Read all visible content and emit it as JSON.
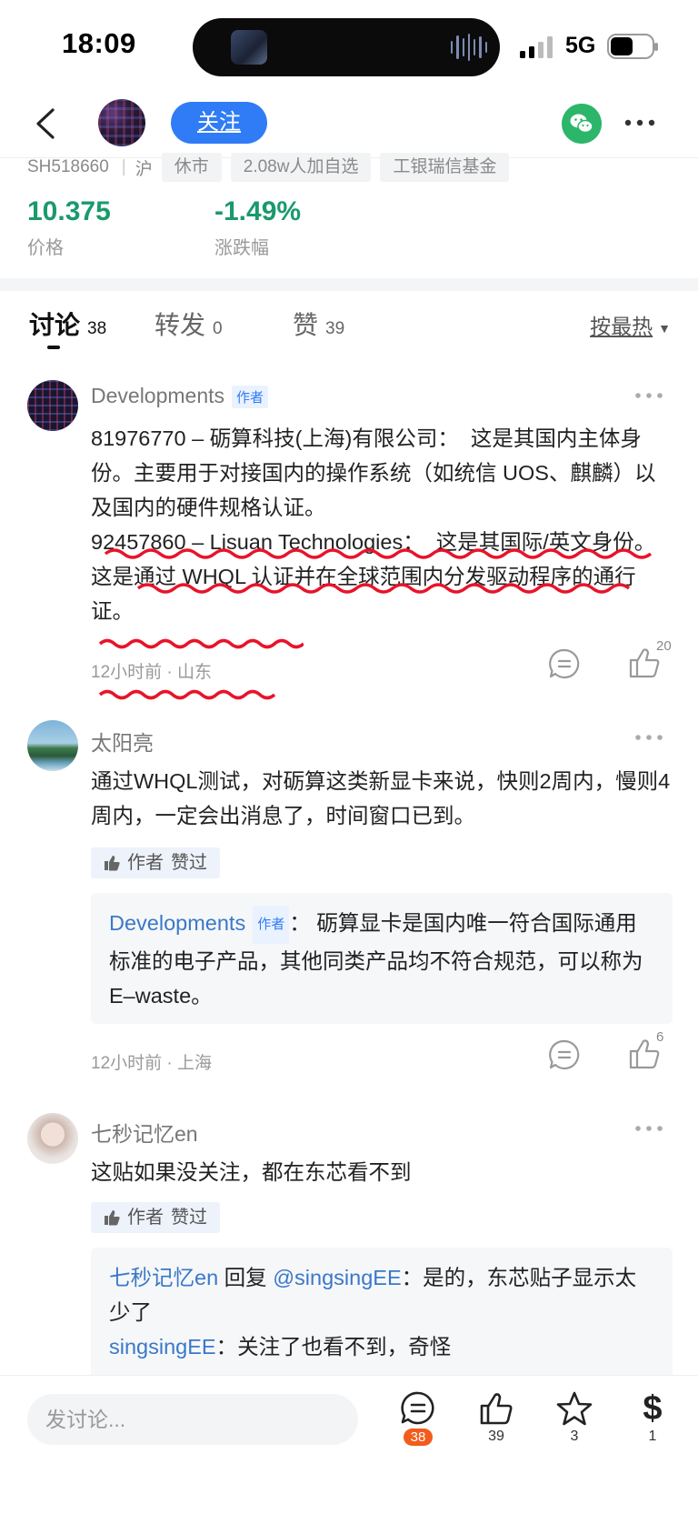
{
  "status_bar": {
    "time": "18:09",
    "network": "5G"
  },
  "nav": {
    "follow_label": "关注"
  },
  "stock": {
    "code": "SH518660",
    "market": "沪",
    "status": "休市",
    "watchers": "2.08w人加自选",
    "company": "工银瑞信基金",
    "price": "10.375",
    "price_label": "价格",
    "change": "-1.49%",
    "change_label": "涨跌幅"
  },
  "tabs": [
    {
      "label": "讨论",
      "count": "38"
    },
    {
      "label": "转发",
      "count": "0"
    },
    {
      "label": "赞",
      "count": "39"
    }
  ],
  "sort_label": "按最热",
  "posts": [
    {
      "author": "Developments",
      "author_badge": "作者",
      "text": "81976770 – 砺算科技(上海)有限公司：  这是其国内主体身份。主要用于对接国内的操作系统（如统信 UOS、麒麟）以及国内的硬件规格认证。\n92457860 – Lisuan Technologies：  这是其国际/英文身份。这是通过 WHQL 认证并在全球范围内分发驱动程序的通行证。",
      "time": "12小时前",
      "location": "山东",
      "likes": "20"
    },
    {
      "author": "太阳亮",
      "text": "通过WHQL测试，对砺算这类新显卡来说，快则2周内，慢则4周内，一定会出消息了，时间窗口已到。",
      "liked_chip": [
        "作者",
        "赞过"
      ],
      "reply_author": "Developments",
      "reply_badge": "作者",
      "reply_text": "：  砺算显卡是国内唯一符合国际通用标准的电子产品，其他同类产品均不符合规范，可以称为E–waste。",
      "time": "12小时前",
      "location": "上海",
      "likes": "6"
    },
    {
      "author": "七秒记忆en",
      "text": "这贴如果没关注，都在东芯看不到",
      "liked_chip": [
        "作者",
        "赞过"
      ],
      "reply1_author": "七秒记忆en",
      "reply1_mid": " 回复 ",
      "reply1_target": "@singsingEE",
      "reply1_text": "：是的，东芯贴子显示太少了",
      "reply2_author": "singsingEE",
      "reply2_text": "：关注了也看不到，奇怪"
    }
  ],
  "bottom_bar": {
    "input_placeholder": "发讨论...",
    "comments": "38",
    "likes": "39",
    "favorites": "3",
    "tips": "1",
    "tip_symbol": "$"
  },
  "colors": {
    "accent": "#2f7cf6",
    "down": "#1a9a6c",
    "badge": "#f25c1c",
    "squiggle": "#e8132a"
  }
}
